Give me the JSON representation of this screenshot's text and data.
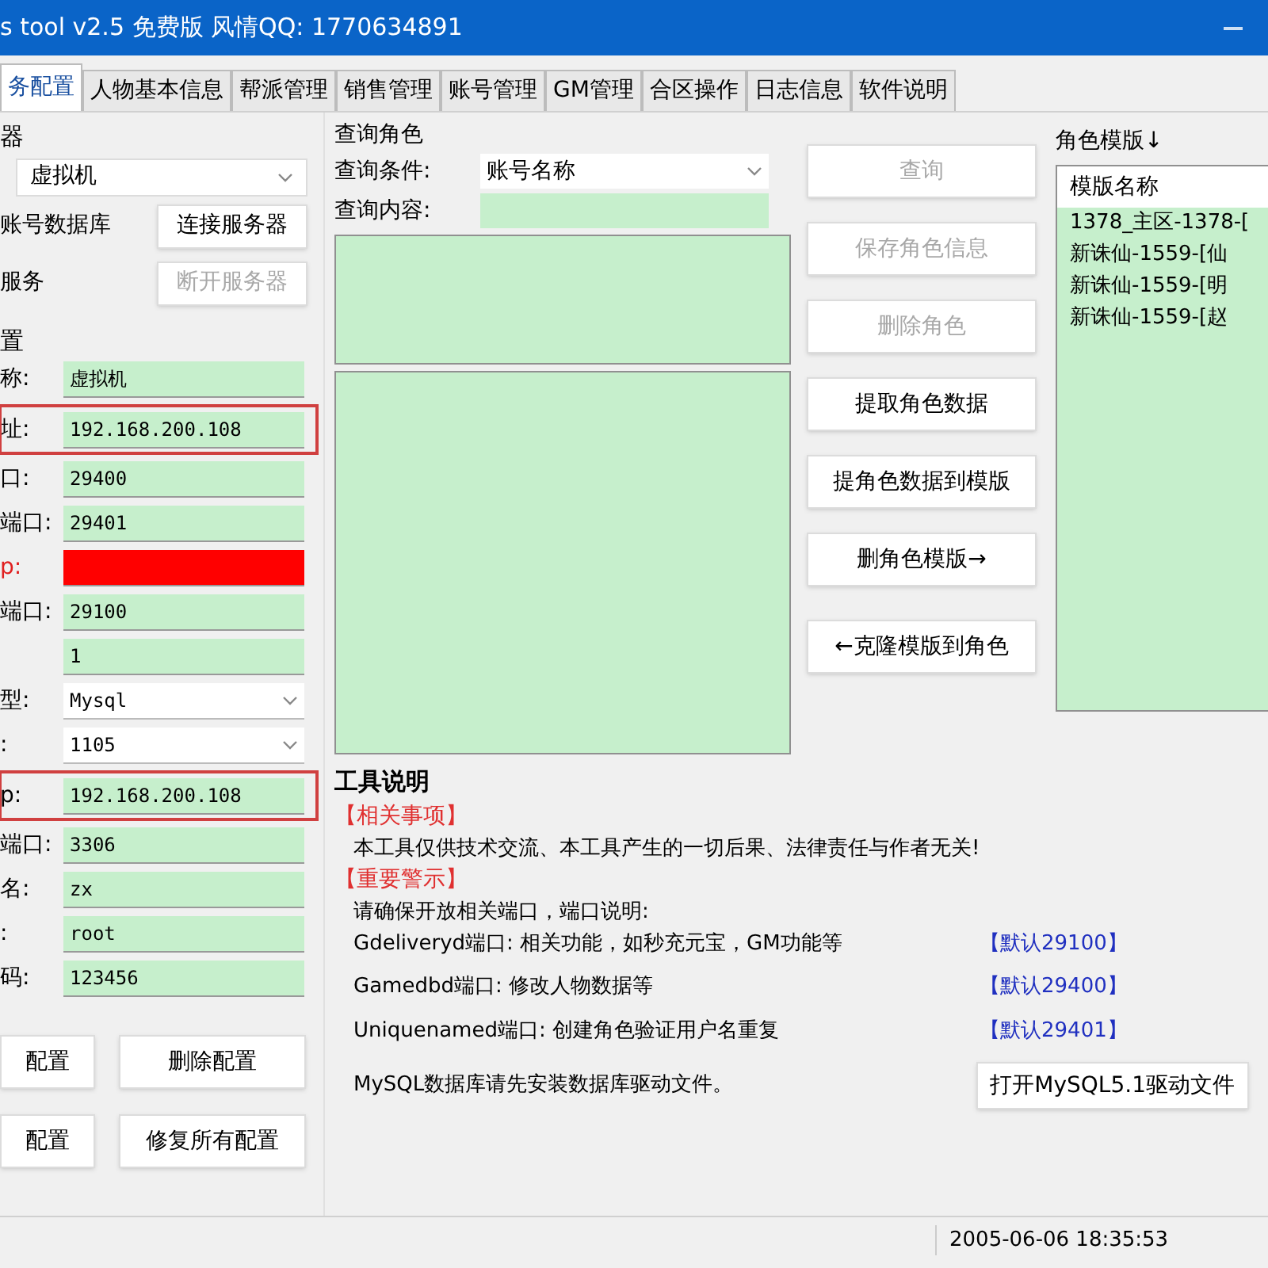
{
  "window": {
    "title": "s tool v2.5 免费版 风情QQ: 1770634891"
  },
  "tabs": [
    {
      "label": "务配置",
      "selected": true
    },
    {
      "label": "人物基本信息",
      "selected": false
    },
    {
      "label": "帮派管理",
      "selected": false
    },
    {
      "label": "销售管理",
      "selected": false
    },
    {
      "label": "账号管理",
      "selected": false
    },
    {
      "label": "GM管理",
      "selected": false
    },
    {
      "label": "合区操作",
      "selected": false
    },
    {
      "label": "日志信息",
      "selected": false
    },
    {
      "label": "软件说明",
      "selected": false
    }
  ],
  "server": {
    "group_title": "器",
    "dropdown_value": "虚拟机",
    "rows": [
      {
        "label": "账号数据库",
        "button": "连接服务器",
        "disabled": false
      },
      {
        "label": "服务",
        "button": "断开服务器",
        "disabled": true
      }
    ]
  },
  "config": {
    "group_title": "置",
    "fields": [
      {
        "label": "称:",
        "value": "虚拟机",
        "kind": "text",
        "outlined": false,
        "alert": false
      },
      {
        "label": "址:",
        "value": "192.168.200.108",
        "kind": "text",
        "outlined": true,
        "alert": false
      },
      {
        "label": "口:",
        "value": "29400",
        "kind": "text",
        "outlined": false,
        "alert": false
      },
      {
        "label": "端口:",
        "value": "29401",
        "kind": "text",
        "outlined": false,
        "alert": false
      },
      {
        "label": "p:",
        "kind": "text",
        "outlined": false,
        "alert": true
      },
      {
        "label": "端口:",
        "value": "29100",
        "kind": "text",
        "outlined": false,
        "alert": false
      },
      {
        "value": "1",
        "kind": "text",
        "outlined": false,
        "alert": false
      },
      {
        "label": "型:",
        "value": "Mysql",
        "kind": "select",
        "outlined": false,
        "alert": false
      },
      {
        "label": ":",
        "value": "1105",
        "kind": "select",
        "outlined": false,
        "alert": false
      },
      {
        "label": "p:",
        "value": "192.168.200.108",
        "kind": "text",
        "outlined": true,
        "alert": false
      },
      {
        "label": "端口:",
        "value": "3306",
        "kind": "text",
        "outlined": false,
        "alert": false
      },
      {
        "label": "名:",
        "value": "zx",
        "kind": "text",
        "outlined": false,
        "alert": false
      },
      {
        "label": ":",
        "value": "root",
        "kind": "text",
        "outlined": false,
        "alert": false
      },
      {
        "label": "码:",
        "value": "123456",
        "kind": "text",
        "outlined": false,
        "alert": false
      }
    ],
    "buttons": [
      "配置",
      "删除配置",
      "配置",
      "修复所有配置"
    ]
  },
  "query": {
    "title": "查询角色",
    "condition_label": "查询条件:",
    "condition_value": "账号名称",
    "content_label": "查询内容:"
  },
  "actions": [
    {
      "label": "查询",
      "disabled": true
    },
    {
      "label": "保存角色信息",
      "disabled": true
    },
    {
      "label": "删除角色",
      "disabled": true
    },
    {
      "label": "提取角色数据",
      "disabled": false
    },
    {
      "label": "提角色数据到模版",
      "disabled": false
    },
    {
      "label": "删角色模版→",
      "disabled": false
    },
    {
      "label": "←克隆模版到角色",
      "disabled": false
    }
  ],
  "templates": {
    "title": "角色模版↓",
    "column": "模版名称",
    "items": [
      "1378_主区-1378-[",
      "新诛仙-1559-[仙",
      "新诛仙-1559-[明",
      "新诛仙-1559-[赵"
    ]
  },
  "help": {
    "title": "工具说明",
    "sections": [
      {
        "heading": "【相关事项】",
        "lines": [
          {
            "text": "本工具仅供技术交流、本工具产生的一切后果、法律责任与作者无关!"
          }
        ]
      },
      {
        "heading": "【重要警示】",
        "lines": [
          {
            "text": "请确保开放相关端口，端口说明:"
          },
          {
            "text": "Gdeliveryd端口: 相关功能，如秒充元宝，GM功能等",
            "note": "【默认29100】"
          },
          {
            "text": "Gamedbd端口: 修改人物数据等",
            "note": "【默认29400】"
          },
          {
            "text": "Uniquenamed端口: 创建角色验证用户名重复",
            "note": "【默认29401】"
          }
        ]
      }
    ],
    "driver_text": "MySQL数据库请先安装数据库驱动文件。",
    "driver_button": "打开MySQL5.1驱动文件"
  },
  "status_bar": {
    "time": "2005-06-06 18:35:53"
  }
}
